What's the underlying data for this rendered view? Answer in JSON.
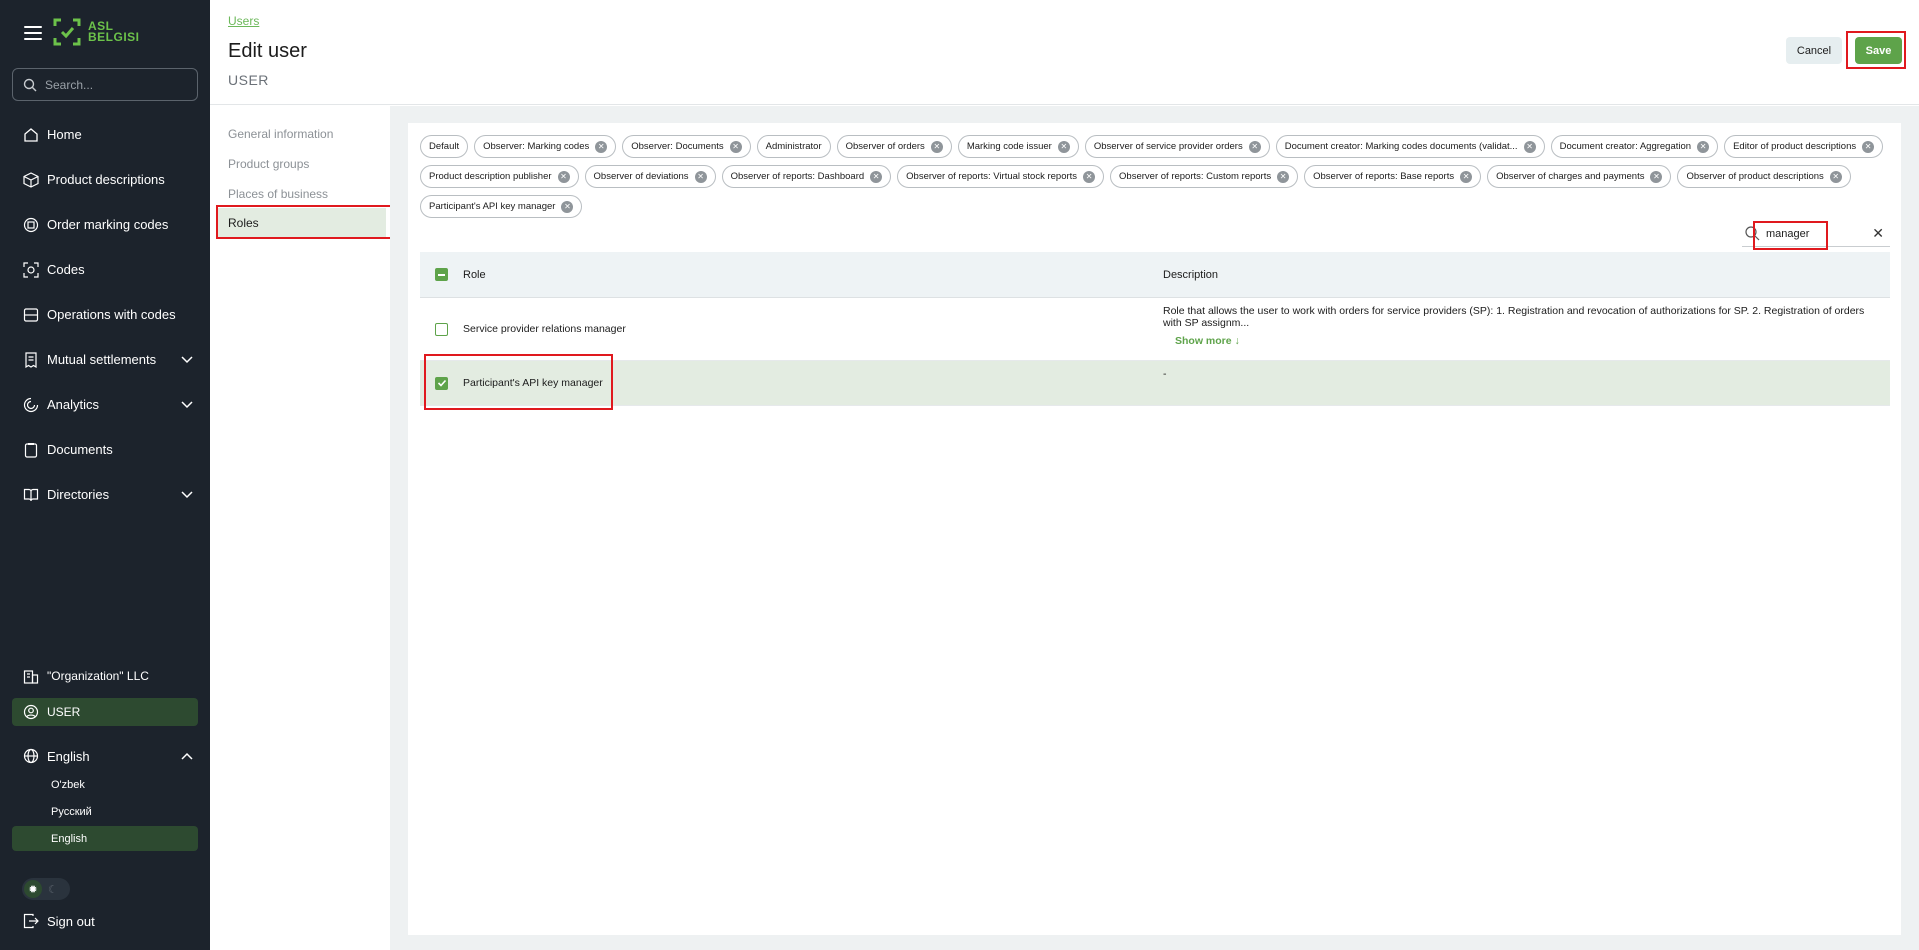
{
  "brand": {
    "line1": "ASL",
    "line2": "BELGISI"
  },
  "sidebar": {
    "search_placeholder": "Search...",
    "items": [
      {
        "label": "Home",
        "icon": "home-icon"
      },
      {
        "label": "Product descriptions",
        "icon": "box-icon"
      },
      {
        "label": "Order marking codes",
        "icon": "order-codes-icon"
      },
      {
        "label": "Codes",
        "icon": "codes-icon"
      },
      {
        "label": "Operations with codes",
        "icon": "operations-icon"
      },
      {
        "label": "Mutual settlements",
        "icon": "receipt-icon",
        "expandable": true
      },
      {
        "label": "Analytics",
        "icon": "analytics-icon",
        "expandable": true
      },
      {
        "label": "Documents",
        "icon": "document-icon"
      },
      {
        "label": "Directories",
        "icon": "book-icon",
        "expandable": true
      }
    ],
    "organization": "\"Organization\" LLC",
    "user": "USER",
    "language": {
      "current": "English",
      "options": [
        "O'zbek",
        "Русский",
        "English"
      ]
    },
    "sign_out": "Sign out"
  },
  "header": {
    "breadcrumb": "Users",
    "title": "Edit user",
    "subtitle": "USER",
    "cancel_label": "Cancel",
    "save_label": "Save"
  },
  "tabs": [
    "General information",
    "Product groups",
    "Places of business",
    "Roles"
  ],
  "active_tab": "Roles",
  "role_chips": [
    {
      "label": "Default",
      "removable": false
    },
    {
      "label": "Observer: Marking codes",
      "removable": true
    },
    {
      "label": "Observer: Documents",
      "removable": true
    },
    {
      "label": "Administrator",
      "removable": false
    },
    {
      "label": "Observer of orders",
      "removable": true
    },
    {
      "label": "Marking code issuer",
      "removable": true
    },
    {
      "label": "Observer of service provider orders",
      "removable": true
    },
    {
      "label": "Document creator: Marking codes documents (validat...",
      "removable": true
    },
    {
      "label": "Document creator: Aggregation",
      "removable": true
    },
    {
      "label": "Editor of product descriptions",
      "removable": true
    },
    {
      "label": "Product description publisher",
      "removable": true
    },
    {
      "label": "Observer of deviations",
      "removable": true
    },
    {
      "label": "Observer of reports: Dashboard",
      "removable": true
    },
    {
      "label": "Observer of reports: Virtual stock reports",
      "removable": true
    },
    {
      "label": "Observer of reports: Custom reports",
      "removable": true
    },
    {
      "label": "Observer of reports: Base reports",
      "removable": true
    },
    {
      "label": "Observer of charges and payments",
      "removable": true
    },
    {
      "label": "Observer of product descriptions",
      "removable": true
    },
    {
      "label": "Participant's API key manager",
      "removable": true
    }
  ],
  "role_search": {
    "value": "manager"
  },
  "table": {
    "headers": {
      "role": "Role",
      "description": "Description"
    },
    "rows": [
      {
        "role": "Service provider relations manager",
        "description": "Role that allows the user to work with orders for service providers (SP): 1. Registration and revocation of authorizations for SP. 2. Registration of orders with SP assignm...",
        "show_more": "Show more ↓",
        "checked": false
      },
      {
        "role": "Participant's API key manager",
        "description": "-",
        "checked": true
      }
    ]
  },
  "colors": {
    "sidebar_bg": "#1c232c",
    "accent": "#5ea34a",
    "highlight": "#e0191e",
    "selected_row": "#e3ece1"
  }
}
